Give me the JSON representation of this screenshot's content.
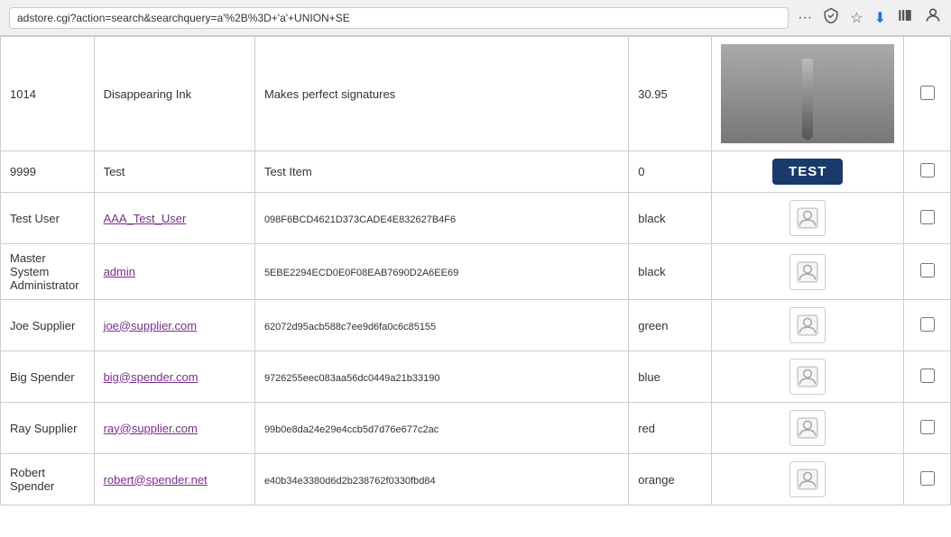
{
  "browser": {
    "url": "adstore.cgi?action=search&searchquery=a'%2B%3D+'a'+UNION+SE",
    "icons": {
      "more": "···",
      "pocket": "⊙",
      "star": "☆",
      "download": "⬇",
      "library": "|||",
      "profile": "◯"
    }
  },
  "rows": [
    {
      "id": "1014",
      "name": "Disappearing Ink",
      "description": "Makes perfect signatures",
      "price": "30.95",
      "image_type": "photo",
      "checked": false
    },
    {
      "id": "9999",
      "name": "Test",
      "description": "Test Item",
      "price": "0",
      "image_type": "test_badge",
      "test_badge_text": "TEST",
      "checked": false
    },
    {
      "id": "Test User",
      "name": "AAA_Test_User",
      "description": "098F6BCD4621D373CADE4E832627B4F6",
      "price": "black",
      "image_type": "icon",
      "checked": false
    },
    {
      "id": "Master System Administrator",
      "name": "admin",
      "description": "5EBE2294ECD0E0F08EAB7690D2A6EE69",
      "price": "black",
      "image_type": "icon",
      "checked": false
    },
    {
      "id": "Joe Supplier",
      "name": "joe@supplier.com",
      "description": "62072d95acb588c7ee9d6fa0c6c85155",
      "price": "green",
      "image_type": "icon",
      "checked": false
    },
    {
      "id": "Big Spender",
      "name": "big@spender.com",
      "description": "9726255eec083aa56dc0449a21b33190",
      "price": "blue",
      "image_type": "icon",
      "checked": false
    },
    {
      "id": "Ray Supplier",
      "name": "ray@supplier.com",
      "description": "99b0e8da24e29e4ccb5d7d76e677c2ac",
      "price": "red",
      "image_type": "icon",
      "checked": false
    },
    {
      "id": "Robert Spender",
      "name": "robert@spender.net",
      "description": "e40b34e3380d6d2b238762f0330fbd84",
      "price": "orange",
      "image_type": "icon",
      "checked": false
    }
  ]
}
